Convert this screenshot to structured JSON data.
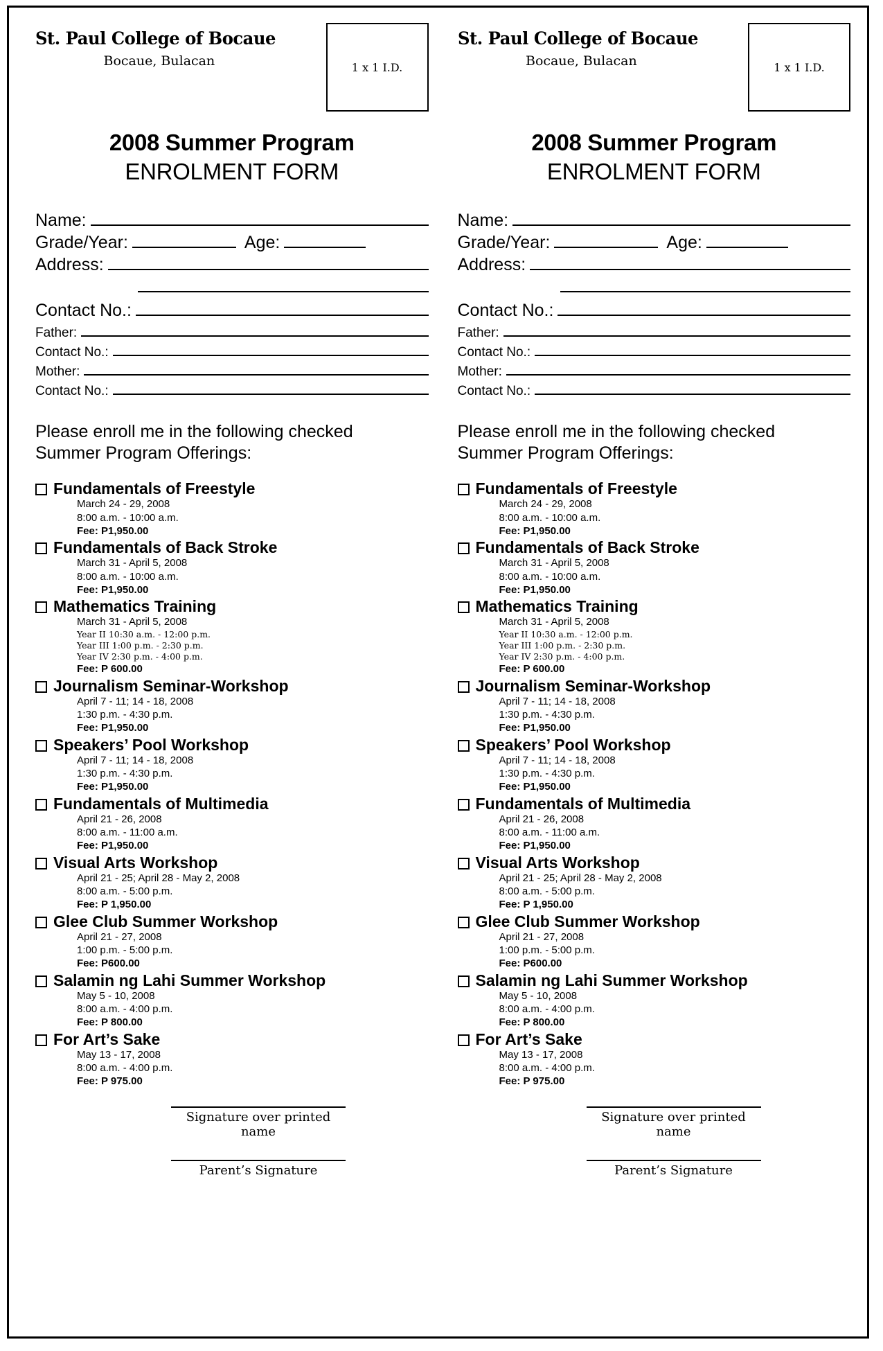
{
  "form": {
    "school_name": "St. Paul College of Bocaue",
    "school_location": "Bocaue, Bulacan",
    "id_box_label": "1 x 1 I.D.",
    "title_line1": "2008 Summer Program",
    "title_line2": "ENROLMENT FORM",
    "fields": {
      "name": "Name:",
      "grade_year": "Grade/Year:",
      "age": "Age:",
      "address": "Address:",
      "contact_no": "Contact No.:",
      "father": "Father:",
      "father_contact": "Contact No.:",
      "mother": "Mother:",
      "mother_contact": "Contact No.:"
    },
    "enroll_text_line1": "Please enroll me in the following checked",
    "enroll_text_line2": "Summer Program Offerings:",
    "offerings": [
      {
        "title": "Fundamentals of Freestyle",
        "dates": "March 24 - 29, 2008",
        "time": "8:00 a.m. - 10:00 a.m.",
        "fee": "Fee: P1,950.00"
      },
      {
        "title": "Fundamentals of Back Stroke",
        "dates": "March 31 - April 5, 2008",
        "time": "8:00 a.m. - 10:00 a.m.",
        "fee": "Fee: P1,950.00"
      },
      {
        "title": "Mathematics Training",
        "dates": "March 31 - April 5, 2008",
        "time_rows": [
          "Year II 10:30 a.m. - 12:00 p.m.",
          "Year III 1:00 p.m. - 2:30 p.m.",
          "Year IV 2:30 p.m. - 4:00 p.m."
        ],
        "fee": "Fee: P 600.00"
      },
      {
        "title": "Journalism Seminar-Workshop",
        "dates": "April 7 - 11; 14 - 18, 2008",
        "time": "1:30 p.m. - 4:30 p.m.",
        "fee": "Fee: P1,950.00"
      },
      {
        "title": "Speakers’ Pool Workshop",
        "dates": "April 7 - 11; 14 - 18, 2008",
        "time": "1:30 p.m. - 4:30 p.m.",
        "fee": "Fee: P1,950.00"
      },
      {
        "title": "Fundamentals of Multimedia",
        "dates": "April 21 - 26, 2008",
        "time": "8:00 a.m. - 11:00 a.m.",
        "fee": "Fee: P1,950.00"
      },
      {
        "title": "Visual Arts Workshop",
        "dates": "April 21 - 25; April 28 - May 2, 2008",
        "time": "8:00 a.m. - 5:00 p.m.",
        "fee": "Fee: P 1,950.00"
      },
      {
        "title": "Glee Club Summer Workshop",
        "dates": "April 21 - 27, 2008",
        "time": "1:00 p.m. - 5:00 p.m.",
        "fee": "Fee: P600.00"
      },
      {
        "title": "Salamin ng Lahi Summer Workshop",
        "dates": "May 5 - 10, 2008",
        "time": "8:00 a.m. - 4:00 p.m.",
        "fee": "Fee: P 800.00"
      },
      {
        "title": "For Art’s Sake",
        "dates": "May 13 - 17, 2008",
        "time": "8:00 a.m. - 4:00 p.m.",
        "fee": "Fee: P 975.00"
      }
    ],
    "signature_label": "Signature over printed name",
    "parent_signature_label": "Parent’s Signature"
  }
}
